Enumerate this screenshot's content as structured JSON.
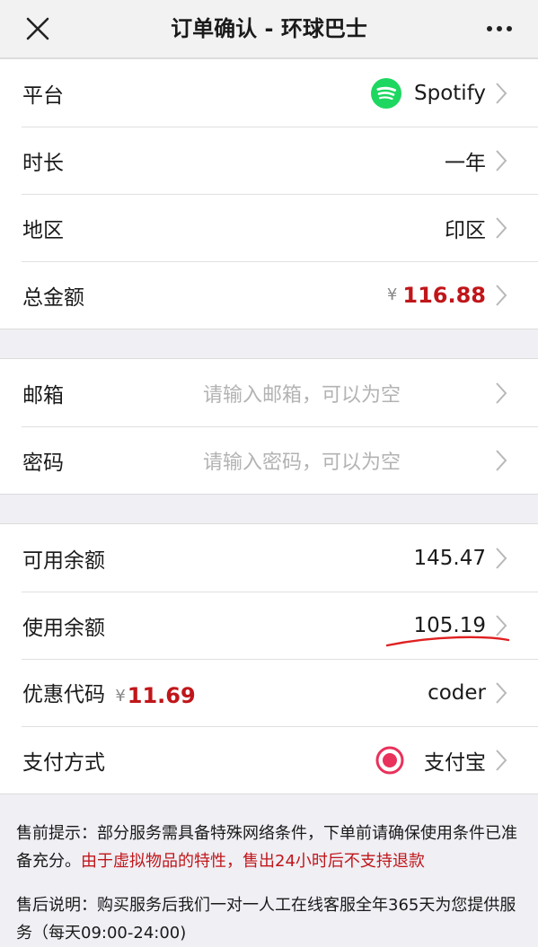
{
  "header": {
    "close_icon": "close-icon",
    "title": "订单确认 - 环球巴士",
    "more_icon": "more-icon"
  },
  "order": {
    "platform_label": "平台",
    "platform_value": "Spotify",
    "platform_icon": "spotify-icon",
    "duration_label": "时长",
    "duration_value": "一年",
    "region_label": "地区",
    "region_value": "印区",
    "total_label": "总金额",
    "total_currency": "¥",
    "total_value": "116.88"
  },
  "account": {
    "email_label": "邮箱",
    "email_placeholder": "请输入邮箱，可以为空",
    "password_label": "密码",
    "password_placeholder": "请输入密码，可以为空"
  },
  "payment": {
    "available_label": "可用余额",
    "available_value": "145.47",
    "use_label": "使用余额",
    "use_value": "105.19",
    "coupon_label": "优惠代码",
    "coupon_currency": "¥",
    "coupon_amount": "11.69",
    "coupon_value": "coder",
    "method_label": "支付方式",
    "method_value": "支付宝"
  },
  "notes": {
    "pre_sale_text": "售前提示：部分服务需具备特殊网络条件，下单前请确保使用条件已准备充分。",
    "pre_sale_warning": "由于虚拟物品的特性，售出24小时后不支持退款",
    "after_sale_text": "售后说明：购买服务后我们一对一人工在线客服全年365天为您提供服务（每天09:00-24:00)"
  },
  "colors": {
    "accent_red": "#c0161a",
    "spotify_green": "#1ed760",
    "radio_pink": "#e8315b"
  }
}
